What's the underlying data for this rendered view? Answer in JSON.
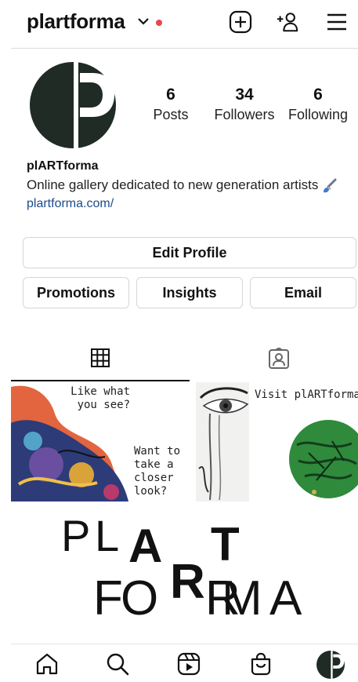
{
  "header": {
    "username": "plartforma"
  },
  "profile": {
    "stats": [
      {
        "value": "6",
        "label": "Posts"
      },
      {
        "value": "34",
        "label": "Followers"
      },
      {
        "value": "6",
        "label": "Following"
      }
    ],
    "display_name": "plARTforma",
    "bio": "Online gallery dedicated to new generation artists",
    "link": "plartforma.com/"
  },
  "buttons": {
    "edit": "Edit Profile",
    "promotions": "Promotions",
    "insights": "Insights",
    "email": "Email"
  },
  "posts": {
    "tile1_top": "Like what you see?",
    "tile1_bottom": "Want to take a closer look?",
    "tile3": "Visit plARTforma."
  },
  "logo": {
    "row1": [
      "P",
      "L",
      "A",
      "R",
      "T"
    ],
    "row2": [
      "F",
      "O",
      "R",
      "M",
      "A"
    ]
  },
  "colors": {
    "accent_dot": "#e5484d",
    "link": "#1b4b8a",
    "avatar": "#1f2b24"
  },
  "icons": [
    "chevron-down-icon",
    "new-post-icon",
    "add-user-icon",
    "menu-icon",
    "grid-icon",
    "tagged-icon",
    "home-icon",
    "search-icon",
    "reels-icon",
    "shop-icon",
    "profile-avatar-icon"
  ]
}
